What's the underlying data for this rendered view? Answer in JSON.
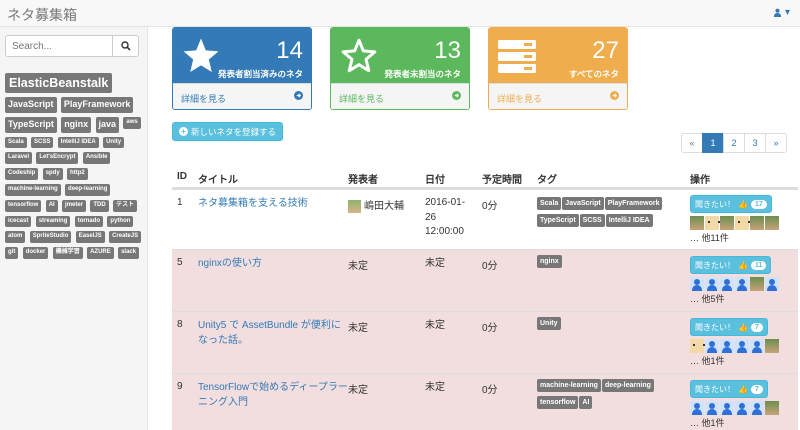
{
  "app": {
    "title": "ネタ募集箱"
  },
  "search": {
    "placeholder": "Search..."
  },
  "tag_cloud": [
    {
      "label": "ElasticBeanstalk",
      "size": "xl"
    },
    {
      "label": "JavaScript",
      "size": "lg"
    },
    {
      "label": "PlayFramework",
      "size": "lg"
    },
    {
      "label": "TypeScript",
      "size": "lg"
    },
    {
      "label": "nginx",
      "size": "lg"
    },
    {
      "label": "java",
      "size": "lg"
    },
    {
      "label": "aws",
      "size": "sm"
    },
    {
      "label": "Scala",
      "size": "sm"
    },
    {
      "label": "SCSS",
      "size": "sm"
    },
    {
      "label": "IntelliJ IDEA",
      "size": "sm"
    },
    {
      "label": "Unity",
      "size": "sm"
    },
    {
      "label": "Laravel",
      "size": "sm"
    },
    {
      "label": "Let'sEncrypt",
      "size": "sm"
    },
    {
      "label": "Ansible",
      "size": "sm"
    },
    {
      "label": "Codeship",
      "size": "sm"
    },
    {
      "label": "spdy",
      "size": "sm"
    },
    {
      "label": "http2",
      "size": "sm"
    },
    {
      "label": "machine-learning",
      "size": "sm"
    },
    {
      "label": "deep-learning",
      "size": "sm"
    },
    {
      "label": "tensorflow",
      "size": "sm"
    },
    {
      "label": "AI",
      "size": "sm"
    },
    {
      "label": "jmeter",
      "size": "sm"
    },
    {
      "label": "TDD",
      "size": "sm"
    },
    {
      "label": "テスト",
      "size": "sm"
    },
    {
      "label": "icecast",
      "size": "sm"
    },
    {
      "label": "streaming",
      "size": "sm"
    },
    {
      "label": "tornado",
      "size": "sm"
    },
    {
      "label": "python",
      "size": "sm"
    },
    {
      "label": "atom",
      "size": "sm"
    },
    {
      "label": "SpriteStudio",
      "size": "sm"
    },
    {
      "label": "EaselJS",
      "size": "sm"
    },
    {
      "label": "CreateJS",
      "size": "sm"
    },
    {
      "label": "git",
      "size": "sm"
    },
    {
      "label": "docker",
      "size": "sm"
    },
    {
      "label": "機械学習",
      "size": "sm"
    },
    {
      "label": "AZURE",
      "size": "sm"
    },
    {
      "label": "slack",
      "size": "sm"
    }
  ],
  "panels": {
    "assigned": {
      "count": "14",
      "caption": "発表者割当済みのネタ",
      "link": "詳細を見る",
      "color": "#337ab7"
    },
    "unassigned": {
      "count": "13",
      "caption": "発表者未割当のネタ",
      "link": "詳細を見る",
      "color": "#5cb85c"
    },
    "all": {
      "count": "27",
      "caption": "すべてのネタ",
      "link": "詳細を見る",
      "color": "#f0ad4e"
    }
  },
  "actions": {
    "new_topic": "新しいネタを登録する"
  },
  "pagination": {
    "prev": "«",
    "pages": [
      "1",
      "2",
      "3"
    ],
    "next": "»",
    "current": "1"
  },
  "table": {
    "headers": {
      "id": "ID",
      "title": "タイトル",
      "presenter": "発表者",
      "date": "日付",
      "duration": "予定時間",
      "tags": "タグ",
      "ops": "操作"
    },
    "want_label": "聞きたい！",
    "rows": [
      {
        "id": "1",
        "title": "ネタ募集箱を支える技術",
        "presenter": "嶋田大輔",
        "date": "2016-01-26 12:00:00",
        "duration": "0分",
        "tags": [
          "Scala",
          "JavaScript",
          "PlayFramework",
          "TypeScript",
          "SCSS",
          "IntelliJ IDEA"
        ],
        "votes": "17",
        "others": "… 他11件"
      },
      {
        "id": "5",
        "title": "nginxの使い方",
        "presenter": "未定",
        "date": "未定",
        "duration": "0分",
        "tags": [
          "nginx"
        ],
        "votes": "11",
        "others": "… 他5件"
      },
      {
        "id": "8",
        "title": "Unity5 で AssetBundle が便利になった話。",
        "presenter": "未定",
        "date": "未定",
        "duration": "0分",
        "tags": [
          "Unity"
        ],
        "votes": "7",
        "others": "… 他1件"
      },
      {
        "id": "9",
        "title": "TensorFlowで始めるディープラーニング入門",
        "presenter": "未定",
        "date": "未定",
        "duration": "0分",
        "tags": [
          "machine-learning",
          "deep-learning",
          "tensorflow",
          "AI"
        ],
        "votes": "7",
        "others": "… 他1件"
      }
    ]
  }
}
